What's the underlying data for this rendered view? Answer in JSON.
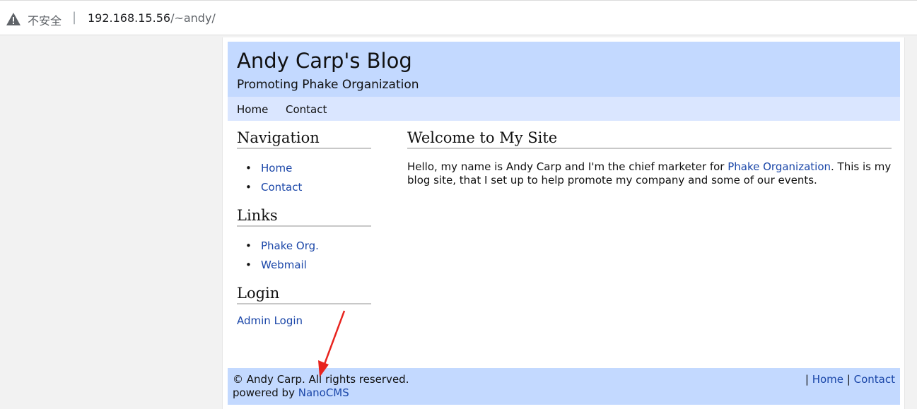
{
  "browser": {
    "security_label": "不安全",
    "separator": "|",
    "url_host": "192.168.15.56",
    "url_path": "/~andy/"
  },
  "header": {
    "title": "Andy Carp's Blog",
    "subtitle": "Promoting Phake Organization"
  },
  "topnav": {
    "items": [
      {
        "label": "Home"
      },
      {
        "label": "Contact"
      }
    ]
  },
  "sidebar": {
    "navigation": {
      "heading": "Navigation",
      "items": [
        {
          "label": "Home"
        },
        {
          "label": "Contact"
        }
      ]
    },
    "links": {
      "heading": "Links",
      "items": [
        {
          "label": "Phake Org."
        },
        {
          "label": "Webmail"
        }
      ]
    },
    "login": {
      "heading": "Login",
      "link": "Admin Login"
    }
  },
  "main": {
    "heading": "Welcome to My Site",
    "text_before": "Hello, my name is Andy Carp and I'm the chief marketer for ",
    "text_link": "Phake Organization",
    "text_after": ". This is my blog site, that I set up to help promote my company and some of our events."
  },
  "footer": {
    "copyright": "© Andy Carp. All rights reserved.",
    "powered_prefix": "powered by ",
    "powered_link": "NanoCMS",
    "sep1": "|",
    "home": "Home",
    "sep2": "|",
    "contact": "Contact"
  },
  "colors": {
    "header_bg": "#c3d9ff",
    "nav_bg": "#dae6ff",
    "link": "#1a46a8",
    "annotation_arrow": "#e8231e"
  },
  "icons": {
    "security": "warning-triangle-icon"
  }
}
